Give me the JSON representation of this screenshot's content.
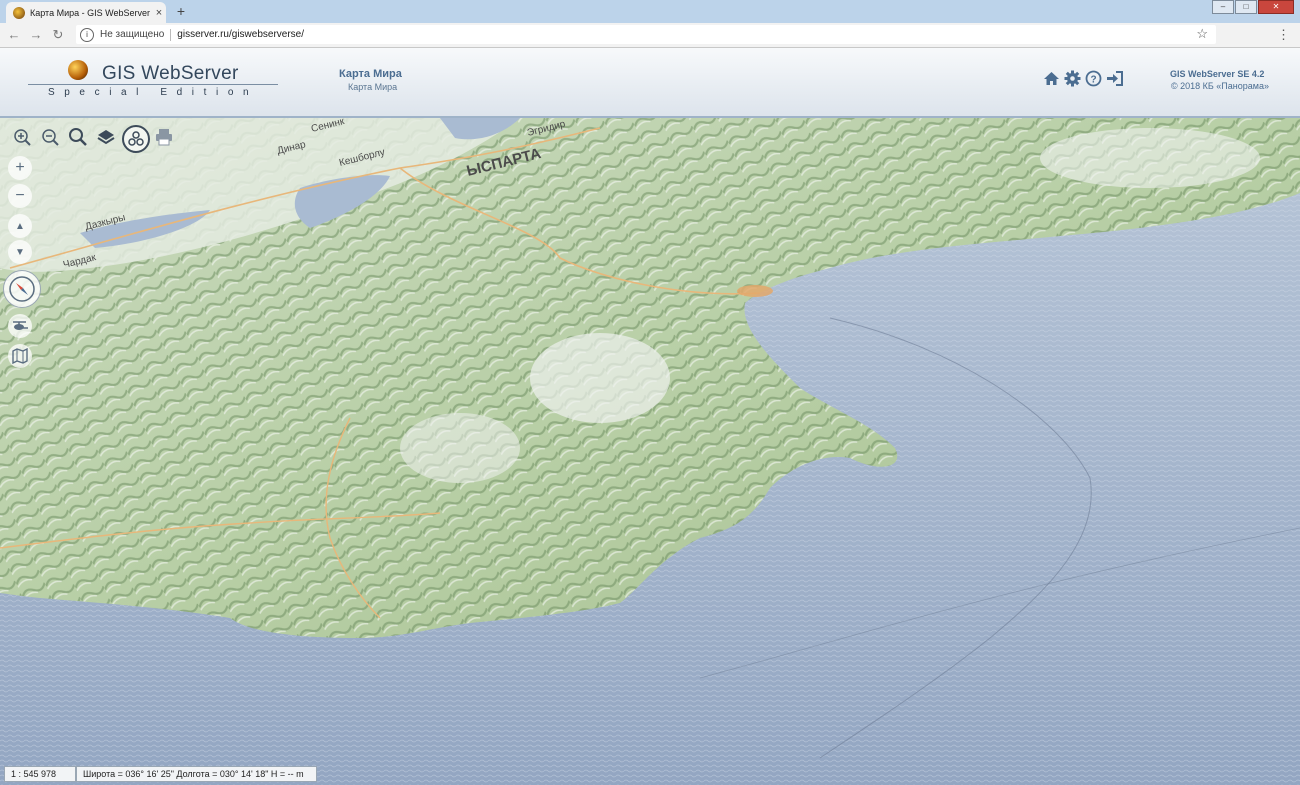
{
  "browser": {
    "tab_title": "Карта Мира - GIS WebServer SE",
    "tab_close": "×",
    "new_tab": "+",
    "security_label": "Не защищено",
    "url": "gisserver.ru/giswebserverse/"
  },
  "header": {
    "logo_title": "GIS WebServer",
    "logo_subtitle": "Special Edition",
    "map_title": "Карта Мира",
    "map_subtitle": "Карта Мира",
    "product": "GIS WebServer SE 4.2",
    "copyright": "© 2018 КБ «Панорама»",
    "icons": [
      "home-icon",
      "gear-icon",
      "help-icon",
      "login-icon"
    ]
  },
  "map": {
    "labels": [
      "Сенинк",
      "Эгридир",
      "Динар",
      "Кешборлу",
      "ЫСПАРТА",
      "Дазкыры",
      "Чардак"
    ],
    "zoom_plus": "+",
    "zoom_minus": "−",
    "tilt_up": "▲",
    "tilt_down": "▼",
    "toolbar_icons": [
      "zoom-in-icon",
      "zoom-out-icon",
      "search-icon",
      "layers-icon",
      "3d-view-icon",
      "print-icon"
    ],
    "side_icons": [
      "compass-icon",
      "helicopter-icon",
      "map-icon"
    ],
    "colors": {
      "sea": "#9fb0c8",
      "land": "#c6d6b5",
      "forest": "#8fb07e",
      "road": "#e8b77a"
    }
  },
  "status": {
    "scale": "1 : 545 978",
    "coords": "Широта = 036° 16' 25\" Долгота = 030° 14' 18\" Н = -- m"
  }
}
